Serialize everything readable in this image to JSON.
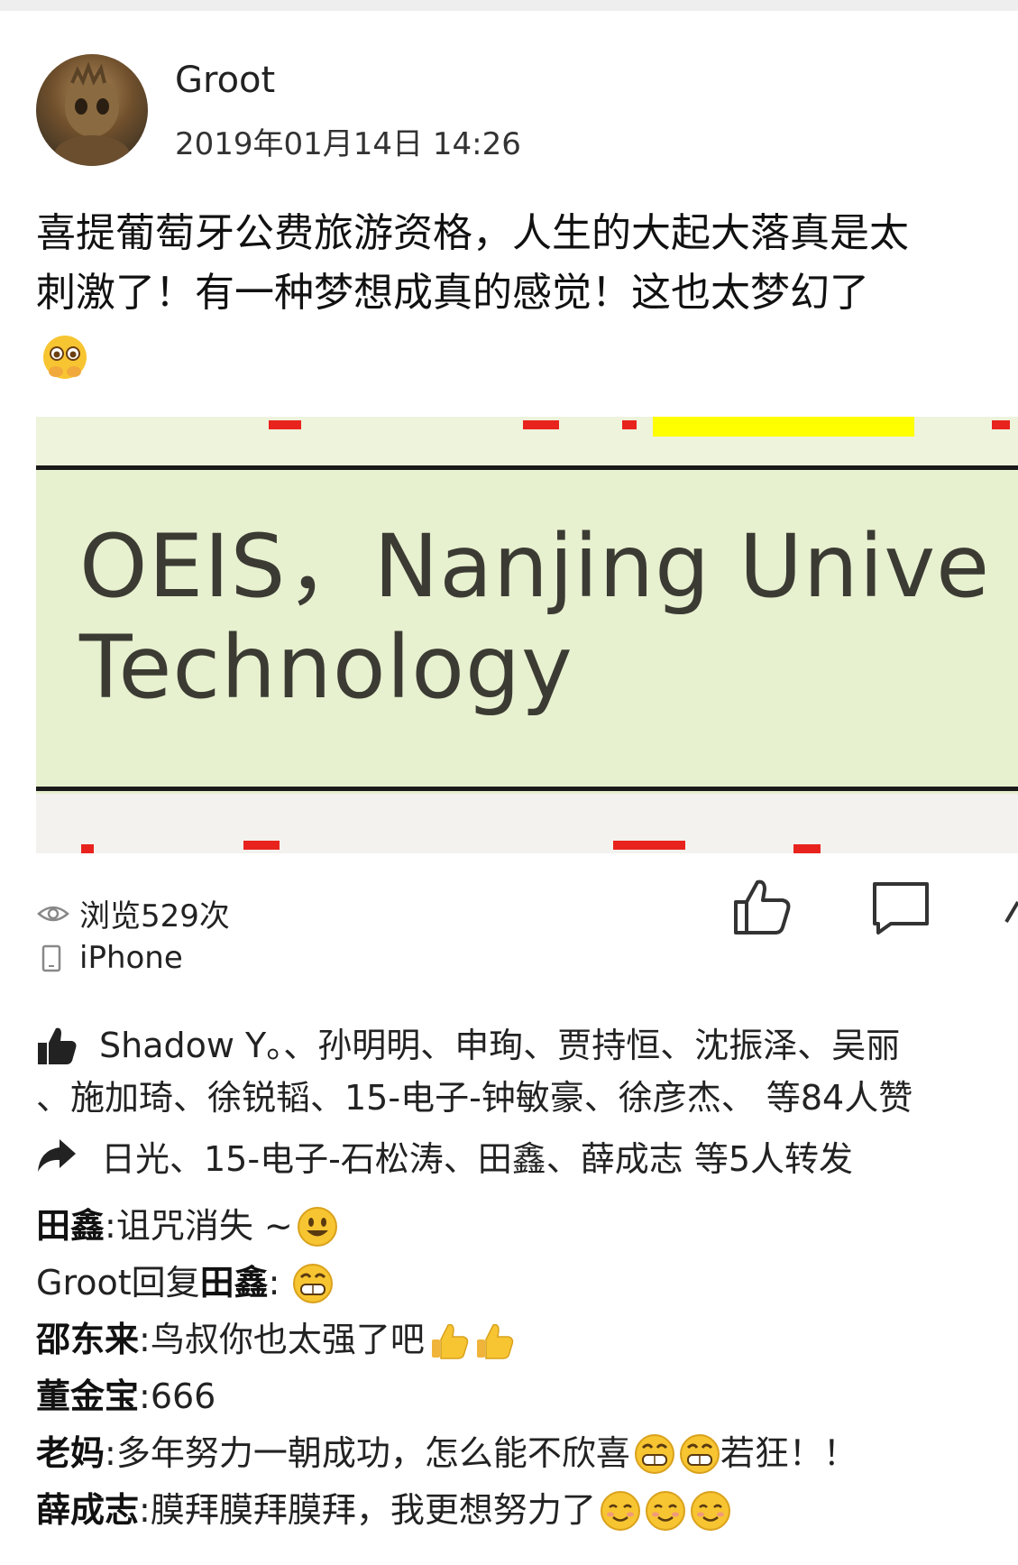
{
  "post": {
    "author": "Groot",
    "timestamp": "2019年01月14日 14:26",
    "content_lines": [
      "喜提葡萄牙公费旅游资格，人生的大起大落真是太",
      "刺激了！有一种梦想成真的感觉！这也太梦幻了"
    ],
    "image_text_line1": "OEIS，Nanjing Unive",
    "image_text_line2": "Technology"
  },
  "meta": {
    "views": "浏览529次",
    "device": "iPhone"
  },
  "likes": {
    "line1": "Shadow Y。、孙明明、申珣、贾持恒、沈振泽、吴丽",
    "line2": "、施加琦、徐锐韬、15-电子-钟敏豪、徐彦杰、 等84人赞"
  },
  "forwards": {
    "text": "日光、15-电子-石松涛、田鑫、薛成志 等5人转发"
  },
  "comments": [
    {
      "author": "田鑫",
      "sep": ": ",
      "text": "诅咒消失 ~",
      "emojis": [
        "smile"
      ]
    },
    {
      "author": "Groot",
      "reply_word": " 回复 ",
      "reply_to": "田鑫",
      "sep": ": ",
      "text": "",
      "emojis": [
        "grin"
      ]
    },
    {
      "author": "邵东来",
      "sep": ": ",
      "text": "鸟叔你也太强了吧",
      "emojis": [
        "thumbs",
        "thumbs"
      ]
    },
    {
      "author": "董金宝",
      "sep": ": ",
      "text": "666",
      "emojis": []
    },
    {
      "author": "老妈",
      "sep": ": ",
      "text": "多年努力一朝成功，怎么能不欣喜",
      "emojis": [
        "grin",
        "grin"
      ],
      "tail": "若狂！！"
    },
    {
      "author": "薛成志",
      "sep": ": ",
      "text": "膜拜膜拜膜拜，我更想努力了",
      "emojis": [
        "blush",
        "blush",
        "blush"
      ]
    }
  ],
  "icons": {
    "eye": "eye-icon",
    "phone": "phone-icon",
    "thumb": "thumbs-up-icon",
    "comment": "comment-icon",
    "share": "share-icon",
    "forward": "forward-arrow-icon"
  },
  "colors": {
    "photo_bg": "#e7f0cf",
    "photo_text": "#3b3b33",
    "highlight_yellow": "#ffff00",
    "red_marks": "#e8231d",
    "emoji_yellow": "#f7c531"
  }
}
